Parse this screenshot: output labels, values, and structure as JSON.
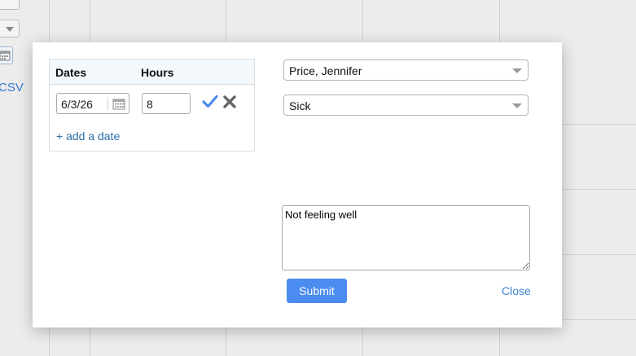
{
  "background": {
    "export_label": "CSV"
  },
  "dates_panel": {
    "col_dates": "Dates",
    "col_hours": "Hours",
    "rows": [
      {
        "date": "6/3/26",
        "hours": "8"
      }
    ],
    "add_date_label": "+ add a date"
  },
  "form": {
    "employee": "Price, Jennifer",
    "leave_type": "Sick",
    "notes": "Not feeling well",
    "submit_label": "Submit",
    "close_label": "Close"
  },
  "colors": {
    "accent": "#4a8cf0",
    "link": "#3a86d0",
    "check": "#4a8cf0",
    "remove": "#666666"
  },
  "icons": [
    "calendar-icon",
    "check-icon",
    "close-x-icon",
    "chevron-down-icon"
  ]
}
